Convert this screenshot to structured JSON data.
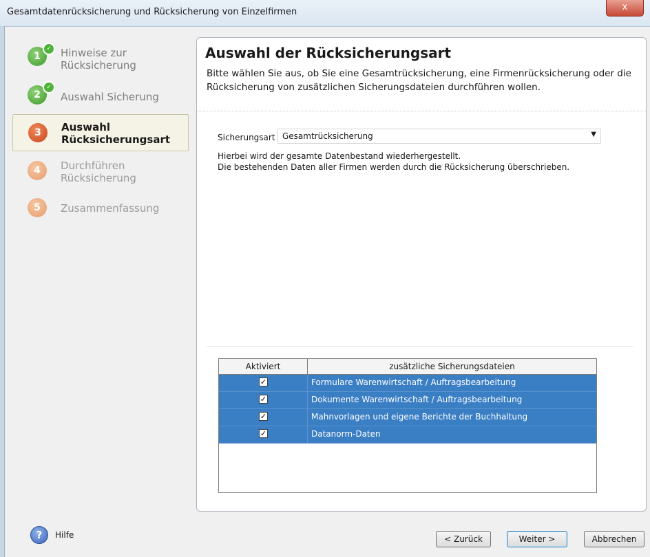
{
  "window": {
    "title": "Gesamtdatenrücksicherung und Rücksicherung von Einzelfirmen",
    "close_label": "x"
  },
  "steps": [
    {
      "number": "1",
      "label": "Hinweise zur Rücksicherung",
      "state": "done"
    },
    {
      "number": "2",
      "label": "Auswahl Sicherung",
      "state": "done"
    },
    {
      "number": "3",
      "label": "Auswahl Rücksicherungsart",
      "state": "active"
    },
    {
      "number": "4",
      "label": "Durchführen Rücksicherung",
      "state": "todo"
    },
    {
      "number": "5",
      "label": "Zusammenfassung",
      "state": "todo"
    }
  ],
  "main": {
    "title": "Auswahl der Rücksicherungsart",
    "description": "Bitte wählen Sie aus, ob Sie eine Gesamtrücksicherung, eine Firmenrücksicherung oder die Rücksicherung von zusätzlichen Sicherungsdateien durchführen wollen.",
    "field_label": "Sicherungsart",
    "select_value": "Gesamtrücksicherung",
    "info_line1": "Hierbei wird der gesamte Datenbestand wiederhergestellt.",
    "info_line2": "Die bestehenden Daten aller Firmen werden durch die Rücksicherung überschrieben."
  },
  "table": {
    "col1": "Aktiviert",
    "col2": "zusätzliche Sicherungsdateien",
    "rows": [
      {
        "checked": true,
        "label": "Formulare Warenwirtschaft / Auftragsbearbeitung"
      },
      {
        "checked": true,
        "label": "Dokumente Warenwirtschaft / Auftragsbearbeitung"
      },
      {
        "checked": true,
        "label": "Mahnvorlagen und eigene Berichte der Buchhaltung"
      },
      {
        "checked": true,
        "label": "Datanorm-Daten"
      }
    ]
  },
  "footer": {
    "help": "Hilfe",
    "back": "< Zurück",
    "next": "Weiter >",
    "cancel": "Abbrechen"
  },
  "colors": {
    "selected_row": "#3a7ec4",
    "step_done": "#3f9a2a",
    "step_active": "#c9431a",
    "step_todo": "#e69c6c"
  }
}
